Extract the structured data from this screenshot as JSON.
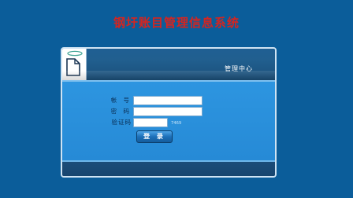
{
  "app": {
    "title": "钢圩账目管理信息系统"
  },
  "panel": {
    "header_label": "管理中心"
  },
  "form": {
    "account_label": "帐 号",
    "password_label": "密 码",
    "captcha_label": "验证码",
    "captcha_value": "7469",
    "login_button": "登 录"
  },
  "colors": {
    "background": "#0b5d9a",
    "title": "#d6241f",
    "panel_body": "#2a8fd9"
  },
  "icons": {
    "logo": "document-icon"
  }
}
